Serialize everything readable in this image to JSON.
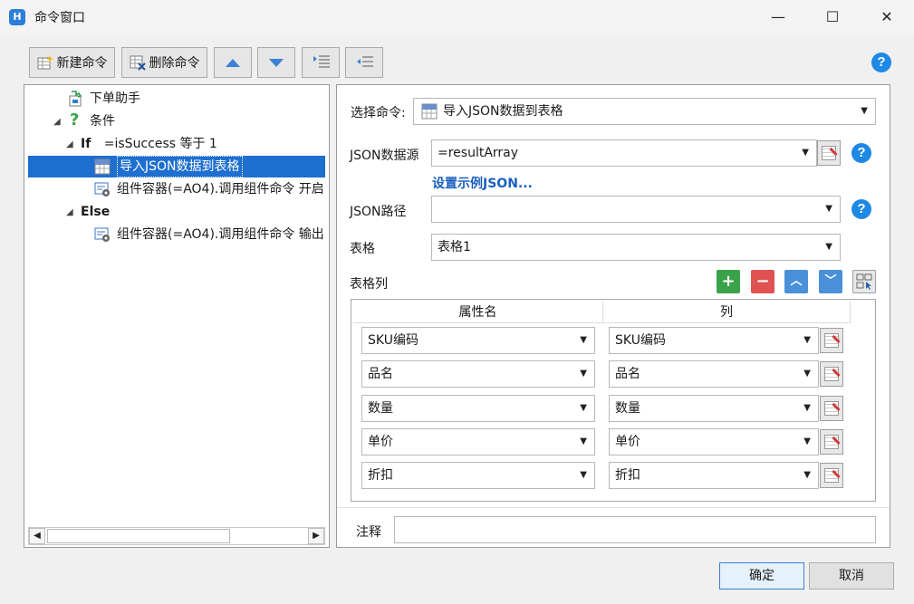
{
  "window": {
    "title": "命令窗口",
    "app_icon_glyph": "H",
    "controls": {
      "minimize": "—",
      "maximize": "☐",
      "close": "✕"
    }
  },
  "toolbar": {
    "new_command": "新建命令",
    "delete_command": "删除命令"
  },
  "help_glyph": "?",
  "tree": {
    "items": [
      {
        "label": "下单助手",
        "icon": "order-assistant-icon"
      },
      {
        "label": "条件",
        "icon": "question-icon"
      },
      {
        "prefix": "If",
        "label": "=isSuccess 等于 1"
      },
      {
        "label": "导入JSON数据到表格",
        "icon": "json-import-icon",
        "selected": true
      },
      {
        "label": "组件容器(=AO4).调用组件命令 开启",
        "icon": "component-command-icon"
      },
      {
        "prefix": "Else",
        "label": ""
      },
      {
        "label": "组件容器(=AO4).调用组件命令 输出",
        "icon": "component-command-icon"
      }
    ]
  },
  "right": {
    "select_command_label": "选择命令:",
    "select_command_value": "导入JSON数据到表格",
    "json_source_label": "JSON数据源",
    "json_source_value": "=resultArray",
    "set_example_json": "设置示例JSON...",
    "json_path_label": "JSON路径",
    "json_path_value": "",
    "table_label": "表格",
    "table_value": "表格1",
    "table_columns_label": "表格列",
    "grid": {
      "headers": [
        "属性名",
        "列"
      ],
      "rows": [
        {
          "property": "SKU编码",
          "column": "SKU编码"
        },
        {
          "property": "品名",
          "column": "品名"
        },
        {
          "property": "数量",
          "column": "数量"
        },
        {
          "property": "单价",
          "column": "单价"
        },
        {
          "property": "折扣",
          "column": "折扣"
        }
      ]
    },
    "note_label": "注释",
    "note_value": ""
  },
  "footer": {
    "ok": "确定",
    "cancel": "取消"
  },
  "colors": {
    "accent": "#1e6fd0",
    "add_green": "#3aa34a",
    "remove_red": "#e05252",
    "move_blue": "#4a90d9",
    "help_blue": "#1e88e5"
  }
}
